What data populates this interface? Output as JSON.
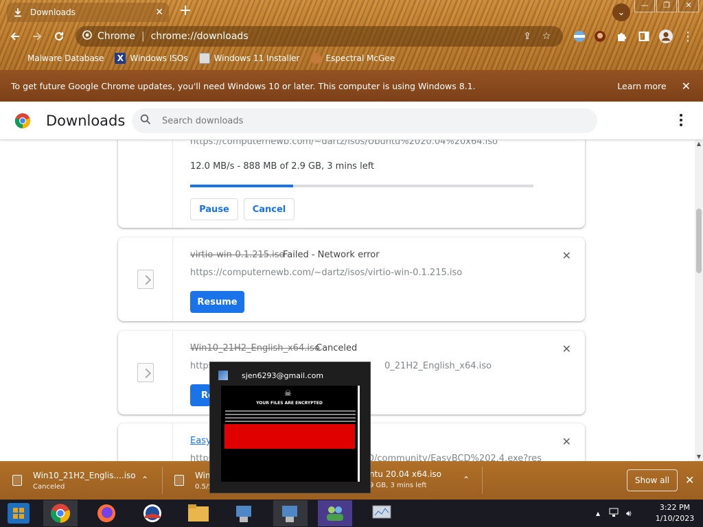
{
  "browser": {
    "tab_title": "Downloads",
    "new_tab_label": "+",
    "omnibox_label": "Chrome",
    "omnibox_separator": "|",
    "url": "chrome://downloads",
    "window_buttons": [
      "—",
      "❐",
      "✕"
    ],
    "bookmarks": [
      {
        "label": "Malware Database",
        "icon": "page-icon",
        "color": "#c88a3c"
      },
      {
        "label": "Windows ISOs",
        "icon": "x-logo-icon",
        "color": "#1e3a8a"
      },
      {
        "label": "Windows 11 Installer",
        "icon": "image-icon",
        "color": "#dcdcdc"
      },
      {
        "label": "Espectral McGee",
        "icon": "avatar-icon",
        "color": "#c47a3a"
      }
    ]
  },
  "infobar": {
    "message": "To get future Google Chrome updates, you'll need Windows 10 or later. This computer is using Windows 8.1.",
    "learn_more": "Learn more",
    "close": "✕"
  },
  "downloads_page": {
    "title": "Downloads",
    "search_placeholder": "Search downloads",
    "items": [
      {
        "url": "https://computernewb.com/~dartz/isos/Ubuntu%2020.04%20x64.iso",
        "progress_text": "12.0 MB/s - 888 MB of 2.9 GB, 3 mins left",
        "progress_percent": 30,
        "pause_label": "Pause",
        "cancel_label": "Cancel"
      },
      {
        "name": "virtio-win-0.1.215.iso",
        "status": "Failed - Network error",
        "url": "https://computernewb.com/~dartz/isos/virtio-win-0.1.215.iso",
        "action_label": "Resume"
      },
      {
        "name": "Win10_21H2_English_x64.iso",
        "status": "Canceled",
        "url_prefix": "https",
        "url_suffix": "0_21H2_English_x64.iso",
        "action_label": "Re"
      },
      {
        "name": "Easy",
        "url_prefix": "https",
        "url_suffix": "D/community/EasyBCD%202.4.exe?res"
      }
    ]
  },
  "shelf": {
    "items": [
      {
        "name": "Win10_21H2_Englis....iso",
        "status": "Canceled"
      },
      {
        "name": "Win",
        "name_tail": "ntu 20.04 x64.iso",
        "status": "0.5/5",
        "status_tail": "9 GB, 3 mins left"
      }
    ],
    "chevron": "⌃",
    "show_all": "Show all",
    "close": "✕"
  },
  "popup": {
    "title": "sjen6293@gmail.com",
    "heading": "YOUR FILES ARE ENCRYPTED"
  },
  "taskbar": {
    "time": "3:22 PM",
    "date": "1/10/2023"
  }
}
